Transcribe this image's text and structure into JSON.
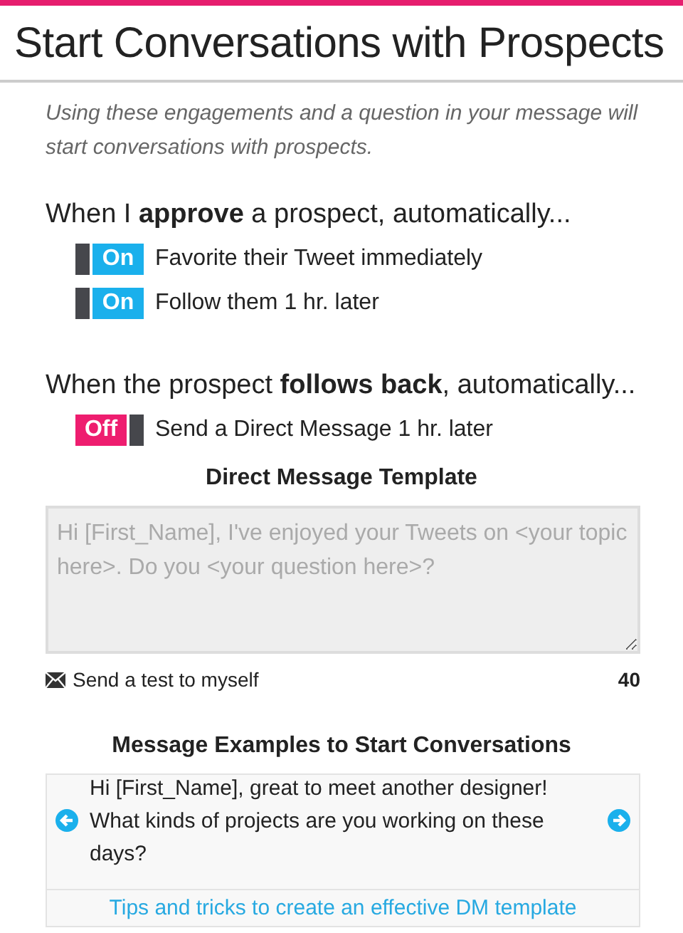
{
  "title": "Start Conversations with Prospects",
  "intro": "Using these engagements and a question in your message will start conversations with prospects.",
  "groups": [
    {
      "heading": "When I **approve** a prospect, automatically...",
      "rules": [
        {
          "on": true,
          "toggle_label": "On",
          "label": "Favorite their Tweet immediately"
        },
        {
          "on": true,
          "toggle_label": "On",
          "label": "Follow them 1 hr. later"
        }
      ]
    },
    {
      "heading": "When the prospect **follows back**, automatically...",
      "rules": [
        {
          "on": false,
          "toggle_label": "Off",
          "label": "Send a Direct Message 1 hr. later"
        }
      ]
    }
  ],
  "template": {
    "heading": "Direct Message Template",
    "placeholder": "Hi [First_Name], I've enjoyed your Tweets on <your topic here>. Do you <your question here>?",
    "send_test": "Send a test to myself",
    "count": "40"
  },
  "examples": {
    "heading": "Message Examples to Start Conversations",
    "text": "Hi [First_Name], great to meet another designer! What kinds of projects are you working on these days?",
    "link": "Tips and tricks to create an effective DM template"
  }
}
